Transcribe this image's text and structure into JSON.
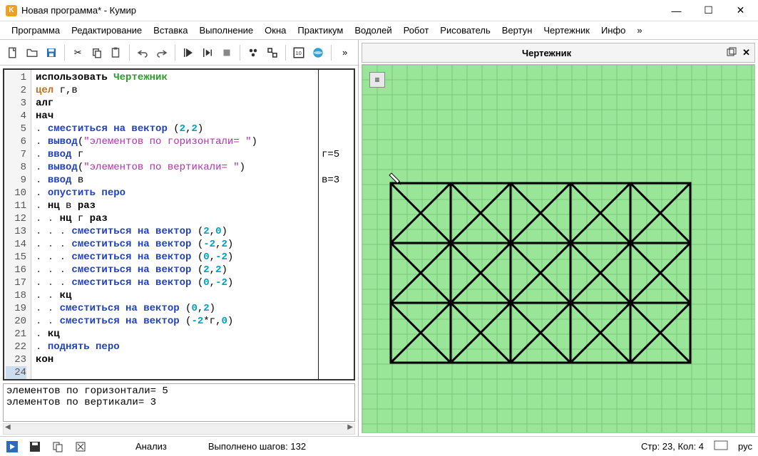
{
  "title": "Новая программа* - Кумир",
  "menus": [
    "Программа",
    "Редактирование",
    "Вставка",
    "Выполнение",
    "Окна",
    "Практикум",
    "Водолей",
    "Робот",
    "Рисователь",
    "Вертун",
    "Чертежник",
    "Инфо",
    "»"
  ],
  "canvas_title": "Чертежник",
  "code_lines": [
    {
      "n": 1,
      "html": "<span class='kw-use'>использовать</span> <span class='kw-actor'>Чертежник</span>"
    },
    {
      "n": 2,
      "html": "<span class='kw-type'>цел</span> г,в"
    },
    {
      "n": 3,
      "html": "<span class='kw-struct'>алг</span>"
    },
    {
      "n": 4,
      "html": "<span class='kw-struct'>нач</span>"
    },
    {
      "n": 5,
      "html": "<span class='dotty'>. </span><span class='kw-cmd'>сместиться на вектор</span> (<span class='kw-num'>2</span>,<span class='kw-num'>2</span>)"
    },
    {
      "n": 6,
      "html": "<span class='dotty'>. </span><span class='kw-cmd'>вывод</span>(<span class='kw-str'>\"элементов по горизонтали= \"</span>)"
    },
    {
      "n": 7,
      "html": "<span class='dotty'>. </span><span class='kw-cmd'>ввод</span> г"
    },
    {
      "n": 8,
      "html": "<span class='dotty'>. </span><span class='kw-cmd'>вывод</span>(<span class='kw-str'>\"элементов по вертикали= \"</span>)"
    },
    {
      "n": 9,
      "html": "<span class='dotty'>. </span><span class='kw-cmd'>ввод</span> в"
    },
    {
      "n": 10,
      "html": "<span class='dotty'>. </span><span class='kw-cmd'>опустить перо</span>"
    },
    {
      "n": 11,
      "html": "<span class='dotty'>. </span><span class='kw-struct'>нц</span> в <span class='kw-struct'>раз</span>"
    },
    {
      "n": 12,
      "html": "<span class='dotty'>. . </span><span class='kw-struct'>нц</span> г <span class='kw-struct'>раз</span>"
    },
    {
      "n": 13,
      "html": "<span class='dotty'>. . . </span><span class='kw-cmd'>сместиться на вектор</span> (<span class='kw-num'>2</span>,<span class='kw-num'>0</span>)"
    },
    {
      "n": 14,
      "html": "<span class='dotty'>. . . </span><span class='kw-cmd'>сместиться на вектор</span> (<span class='kw-num'>-2</span>,<span class='kw-num'>2</span>)"
    },
    {
      "n": 15,
      "html": "<span class='dotty'>. . . </span><span class='kw-cmd'>сместиться на вектор</span> (<span class='kw-num'>0</span>,<span class='kw-num'>-2</span>)"
    },
    {
      "n": 16,
      "html": "<span class='dotty'>. . . </span><span class='kw-cmd'>сместиться на вектор</span> (<span class='kw-num'>2</span>,<span class='kw-num'>2</span>)"
    },
    {
      "n": 17,
      "html": "<span class='dotty'>. . . </span><span class='kw-cmd'>сместиться на вектор</span> (<span class='kw-num'>0</span>,<span class='kw-num'>-2</span>)"
    },
    {
      "n": 18,
      "html": "<span class='dotty'>. . </span><span class='kw-struct'>кц</span>"
    },
    {
      "n": 19,
      "html": "<span class='dotty'>. . </span><span class='kw-cmd'>сместиться на вектор</span> (<span class='kw-num'>0</span>,<span class='kw-num'>2</span>)"
    },
    {
      "n": 20,
      "html": "<span class='dotty'>. . </span><span class='kw-cmd'>сместиться на вектор</span> (<span class='kw-num'>-2</span>*г,<span class='kw-num'>0</span>)"
    },
    {
      "n": 21,
      "html": "<span class='dotty'>. </span><span class='kw-struct'>кц</span>"
    },
    {
      "n": 22,
      "html": "<span class='dotty'>. </span><span class='kw-cmd'>поднять перо</span>"
    },
    {
      "n": 23,
      "html": "<span class='kw-struct'>кон</span>"
    },
    {
      "n": 24,
      "html": " "
    }
  ],
  "margin_notes": {
    "7": "г=5",
    "9": "в=3"
  },
  "console_lines": [
    "элементов по горизонтали= 5",
    "элементов по вертикали= 3"
  ],
  "status": {
    "analysis": "Анализ",
    "steps": "Выполнено шагов: 132",
    "pos": "Стр: 23, Кол: 4",
    "lang": "рус"
  },
  "drawing_params": {
    "cols": 5,
    "rows": 3,
    "cell": 42,
    "ox": 40,
    "oy": 166
  }
}
